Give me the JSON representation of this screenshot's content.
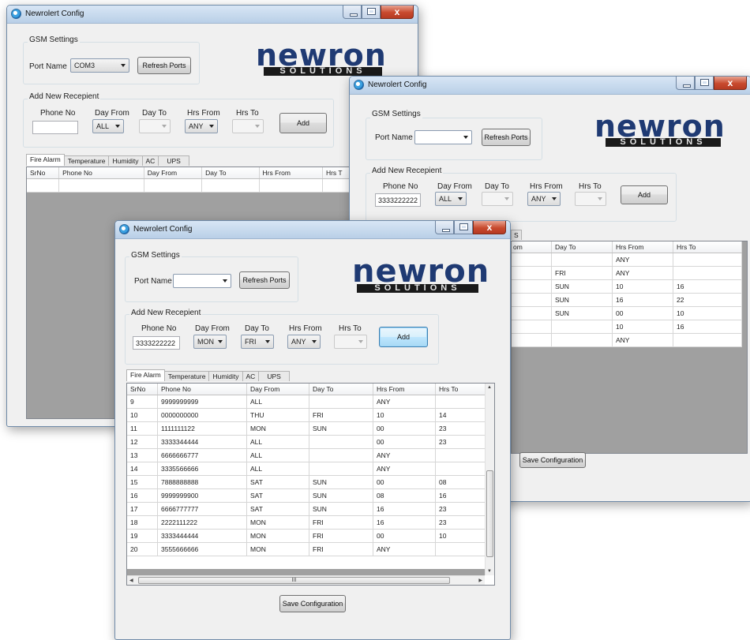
{
  "app_title": "Newrolert Config",
  "gsm_settings": {
    "title": "GSM Settings",
    "port_label": "Port Name",
    "refresh_label": "Refresh Ports"
  },
  "add_recipient": {
    "title": "Add New Recepient",
    "phone_label": "Phone No",
    "day_from_label": "Day From",
    "day_to_label": "Day To",
    "hrs_from_label": "Hrs From",
    "hrs_to_label": "Hrs To",
    "add_label": "Add"
  },
  "logo": {
    "main": "newron",
    "sub": "SOLUTIONS"
  },
  "tabs": [
    "Fire Alarm",
    "Temperature",
    "Humidity",
    "AC",
    "UPS"
  ],
  "save_label": "Save Configuration",
  "columns": [
    "SrNo",
    "Phone No",
    "Day From",
    "Day To",
    "Hrs From",
    "Hrs To"
  ],
  "window1": {
    "port_value": "COM3",
    "phone_value": "",
    "day_from_value": "ALL",
    "hrs_from_value": "ANY",
    "visible_columns": [
      "SrNo",
      "Phone No",
      "Day From",
      "Day To",
      "Hrs From",
      "Hrs T"
    ]
  },
  "window2": {
    "port_value": "",
    "phone_value": "3333222222",
    "day_from_value": "ALL",
    "hrs_from_value": "ANY",
    "tab_fragment": "S",
    "visible_columns": [
      "om",
      "Day To",
      "Hrs From",
      "Hrs To"
    ],
    "rows": [
      [
        "",
        "",
        "ANY",
        ""
      ],
      [
        "",
        "FRI",
        "ANY",
        ""
      ],
      [
        "",
        "SUN",
        "10",
        "16"
      ],
      [
        "",
        "SUN",
        "16",
        "22"
      ],
      [
        "",
        "SUN",
        "00",
        "10"
      ],
      [
        "",
        "",
        "10",
        "16"
      ],
      [
        "",
        "",
        "ANY",
        ""
      ]
    ]
  },
  "window3": {
    "port_value": "",
    "phone_value": "3333222222",
    "day_from_value": "MON",
    "day_to_value": "FRI",
    "hrs_from_value": "ANY",
    "rows": [
      [
        "9",
        "9999999999",
        "ALL",
        "",
        "ANY",
        ""
      ],
      [
        "10",
        "0000000000",
        "THU",
        "FRI",
        "10",
        "14"
      ],
      [
        "11",
        "1111111122",
        "MON",
        "SUN",
        "00",
        "23"
      ],
      [
        "12",
        "3333344444",
        "ALL",
        "",
        "00",
        "23"
      ],
      [
        "13",
        "6666666777",
        "ALL",
        "",
        "ANY",
        ""
      ],
      [
        "14",
        "3335566666",
        "ALL",
        "",
        "ANY",
        ""
      ],
      [
        "15",
        "7888888888",
        "SAT",
        "SUN",
        "00",
        "08"
      ],
      [
        "16",
        "9999999900",
        "SAT",
        "SUN",
        "08",
        "16"
      ],
      [
        "17",
        "6666777777",
        "SAT",
        "SUN",
        "16",
        "23"
      ],
      [
        "18",
        "2222111222",
        "MON",
        "FRI",
        "16",
        "23"
      ],
      [
        "19",
        "3333444444",
        "MON",
        "FRI",
        "00",
        "10"
      ],
      [
        "20",
        "3555666666",
        "MON",
        "FRI",
        "ANY",
        ""
      ]
    ],
    "hscroll_glyph": "III"
  }
}
